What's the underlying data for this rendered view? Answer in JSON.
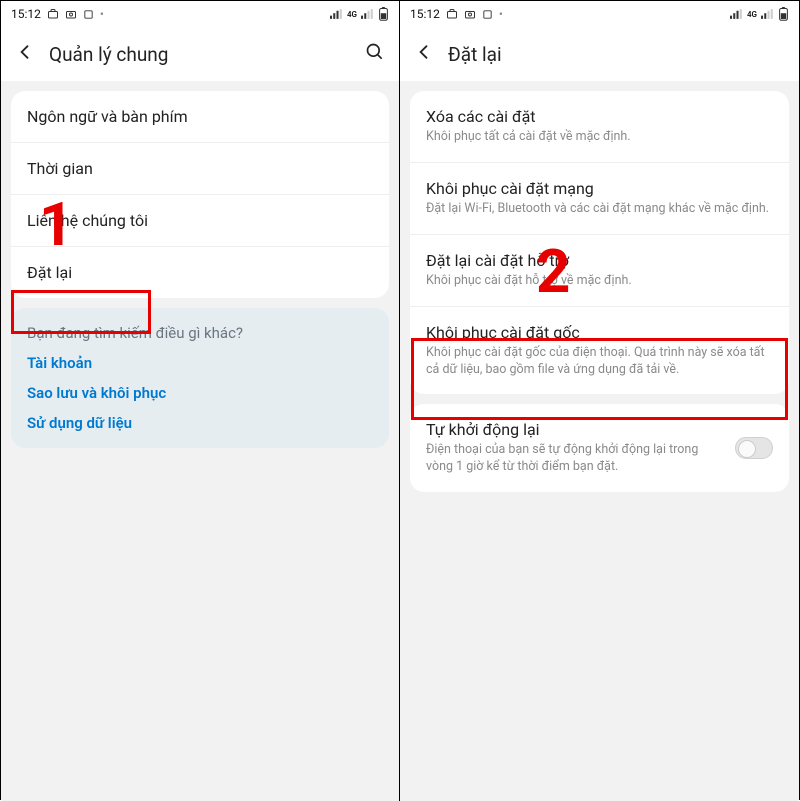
{
  "statusbar": {
    "time": "15:12",
    "network_label": "4G"
  },
  "left": {
    "header": {
      "title": "Quản lý chung"
    },
    "rows": [
      {
        "title": "Ngôn ngữ và bàn phím"
      },
      {
        "title": "Thời gian"
      },
      {
        "title": "Liên hệ chúng tôi"
      },
      {
        "title": "Đặt lại"
      }
    ],
    "suggest": {
      "question": "Bạn đang tìm kiếm điều gì khác?",
      "links": [
        "Tài khoản",
        "Sao lưu và khôi phục",
        "Sử dụng dữ liệu"
      ]
    },
    "annotation": "1"
  },
  "right": {
    "header": {
      "title": "Đặt lại"
    },
    "rows": [
      {
        "title": "Xóa các cài đặt",
        "sub": "Khôi phục tất cả cài đặt về mặc định."
      },
      {
        "title": "Khôi phục cài đặt mạng",
        "sub": "Đặt lại Wi-Fi, Bluetooth và các cài đặt mạng khác về mặc định."
      },
      {
        "title": "Đặt lại cài đặt hỗ trợ",
        "sub": "Khôi phục cài đặt hỗ trợ về mặc định."
      },
      {
        "title": "Khôi phục cài đặt gốc",
        "sub": "Khôi phục cài đặt gốc của điện thoại. Quá trình này sẽ xóa tất cả dữ liệu, bao gồm file và ứng dụng đã tải về."
      }
    ],
    "autorestart": {
      "title": "Tự khởi động lại",
      "sub": "Điện thoại của bạn sẽ tự động khởi động lại trong vòng 1 giờ kể từ thời điểm bạn đặt."
    },
    "annotation": "2"
  }
}
